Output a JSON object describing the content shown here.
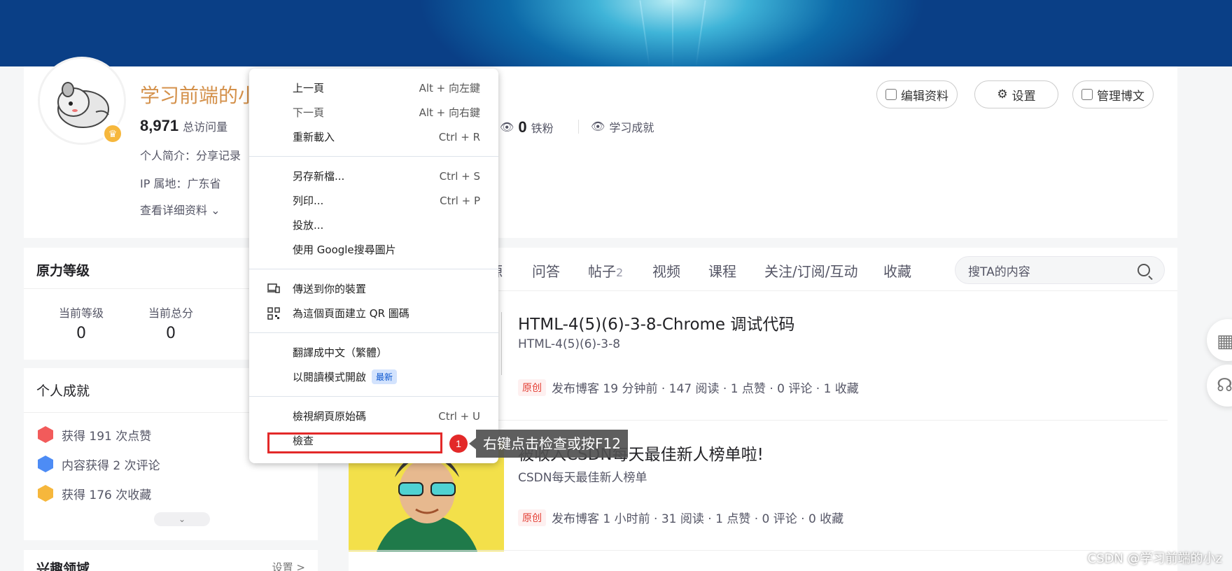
{
  "profile": {
    "name": "学习前端的小",
    "visits": "8,971",
    "visits_label": "总访问量",
    "fans_count": "0",
    "fans_label": "铁粉",
    "learning_label": "学习成就",
    "intro": "个人简介：分享记录",
    "ip": "IP 属地：广东省",
    "details_link": "查看详细资料",
    "buttons": {
      "edit": "编辑资料",
      "settings": "设置",
      "manage": "管理博文"
    }
  },
  "level_card": {
    "title": "原力等级",
    "current_level_label": "当前等级",
    "current_level": "0",
    "current_score_label": "当前总分",
    "current_score": "0"
  },
  "achievements": {
    "title": "个人成就",
    "items": [
      {
        "text": "获得 191 次点赞",
        "color": "#f25b5b"
      },
      {
        "text": "内容获得 2 次评论",
        "color": "#4d8cf5"
      },
      {
        "text": "获得 176 次收藏",
        "color": "#f6b73c"
      }
    ]
  },
  "interest": {
    "title": "兴趣领域",
    "settings": "设置 >"
  },
  "tabs": {
    "partial": "源",
    "items": [
      "问答",
      "帖子",
      "视频",
      "课程",
      "关注/订阅/互动",
      "收藏"
    ],
    "posts_count": "2",
    "search_placeholder": "搜TA的内容"
  },
  "articles": [
    {
      "title": "HTML-4(5)(6)-3-8-Chrome 调试代码",
      "desc": "HTML-4(5)(6)-3-8",
      "tag": "原创",
      "meta": "发布博客 19 分钟前 ·  147 阅读 ·  1 点赞 ·  0 评论 ·  1 收藏"
    },
    {
      "title": "被收入CSDN每天最佳新人榜单啦!",
      "desc": "CSDN每天最佳新人榜单",
      "tag": "原创",
      "meta": "发布博客 1 小时前 ·  31 阅读 ·  1 点赞 ·  0 评论 ·  0 收藏"
    }
  ],
  "context_menu": {
    "groups": [
      [
        {
          "label": "上一頁",
          "shortcut": "Alt + 向左鍵"
        },
        {
          "label": "下一頁",
          "shortcut": "Alt + 向右鍵"
        },
        {
          "label": "重新載入",
          "shortcut": "Ctrl + R"
        }
      ],
      [
        {
          "label": "另存新檔...",
          "shortcut": "Ctrl + S"
        },
        {
          "label": "列印...",
          "shortcut": "Ctrl + P"
        },
        {
          "label": "投放...",
          "shortcut": ""
        },
        {
          "label": "使用 Google搜尋圖片",
          "shortcut": ""
        }
      ],
      [
        {
          "label": "傳送到你的裝置",
          "shortcut": "",
          "icon": "device-icon"
        },
        {
          "label": "為這個頁面建立 QR 圖碼",
          "shortcut": "",
          "icon": "qr-code-icon"
        }
      ],
      [
        {
          "label": "翻譯成中文（繁體）",
          "shortcut": ""
        },
        {
          "label": "以閱讀模式開啟",
          "shortcut": "",
          "badge": "最新"
        }
      ],
      [
        {
          "label": "檢視網頁原始碼",
          "shortcut": "Ctrl + U"
        },
        {
          "label": "檢查",
          "shortcut": ""
        }
      ]
    ]
  },
  "annotation": {
    "step": "1",
    "tip": "右键点击检查或按F12"
  },
  "watermark": "CSDN @学习前端的小z",
  "colors": {
    "accent_red": "#e32929",
    "name_color": "#d4914b"
  }
}
